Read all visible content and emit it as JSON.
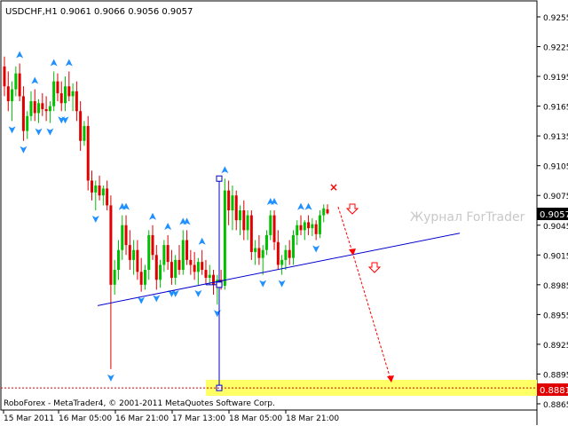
{
  "window": {
    "symbol_header": "USDCHF,H1  0.9061 0.9066 0.9056 0.9057",
    "footer_text": "RoboForex - MetaTrader4, © 2001-2011 MetaQuotes Software Corp.",
    "watermark": "Журнал ForTrader"
  },
  "chart_data": {
    "type": "candlestick",
    "title": "USDCHF,H1",
    "ohlc_header": {
      "open": 0.9061,
      "high": 0.9066,
      "low": 0.9056,
      "close": 0.9057
    },
    "ylim": [
      0.8865,
      0.9255
    ],
    "y_ticks": [
      "0.9255",
      "0.9225",
      "0.9195",
      "0.9165",
      "0.9135",
      "0.9105",
      "0.9075",
      "0.9045",
      "0.9015",
      "0.8985",
      "0.8955",
      "0.8925",
      "0.8895",
      "0.8865"
    ],
    "x_ticks": [
      "15 Mar 2011",
      "16 Mar 05:00",
      "16 Mar 21:00",
      "17 Mar 13:00",
      "18 Mar 05:00",
      "18 Mar 21:00"
    ],
    "current_price_label": "0.9057",
    "target_price_label": "0.8881",
    "current_price": 0.9057,
    "target_price": 0.8881,
    "trendline": {
      "x_start": "16 Mar 17:00",
      "y_start": 0.8964,
      "x_end": "19 Mar 10:00",
      "y_end": 0.9037
    },
    "forecast_path": [
      {
        "x": "18 Mar 23:00",
        "y": 0.9064
      },
      {
        "x": "19 Mar 01:00",
        "y": 0.9018
      },
      {
        "x": "19 Mar 03:00",
        "y": 0.892
      },
      {
        "x": "19 Mar 05:00",
        "y": 0.8888
      }
    ],
    "candles": [
      {
        "o": 0.9205,
        "h": 0.9215,
        "l": 0.9175,
        "c": 0.9185
      },
      {
        "o": 0.9185,
        "h": 0.92,
        "l": 0.916,
        "c": 0.917
      },
      {
        "o": 0.917,
        "h": 0.919,
        "l": 0.915,
        "c": 0.9182
      },
      {
        "o": 0.9182,
        "h": 0.9205,
        "l": 0.9175,
        "c": 0.9198
      },
      {
        "o": 0.9198,
        "h": 0.9208,
        "l": 0.917,
        "c": 0.9175
      },
      {
        "o": 0.9175,
        "h": 0.9185,
        "l": 0.913,
        "c": 0.914
      },
      {
        "o": 0.914,
        "h": 0.916,
        "l": 0.9132,
        "c": 0.9155
      },
      {
        "o": 0.9155,
        "h": 0.918,
        "l": 0.915,
        "c": 0.917
      },
      {
        "o": 0.917,
        "h": 0.9182,
        "l": 0.915,
        "c": 0.9158
      },
      {
        "o": 0.9158,
        "h": 0.9172,
        "l": 0.9148,
        "c": 0.9168
      },
      {
        "o": 0.9168,
        "h": 0.9178,
        "l": 0.9155,
        "c": 0.9162
      },
      {
        "o": 0.9162,
        "h": 0.9175,
        "l": 0.915,
        "c": 0.916
      },
      {
        "o": 0.916,
        "h": 0.917,
        "l": 0.9148,
        "c": 0.9165
      },
      {
        "o": 0.9165,
        "h": 0.92,
        "l": 0.916,
        "c": 0.919
      },
      {
        "o": 0.919,
        "h": 0.9198,
        "l": 0.917,
        "c": 0.9178
      },
      {
        "o": 0.9178,
        "h": 0.919,
        "l": 0.916,
        "c": 0.9168
      },
      {
        "o": 0.9168,
        "h": 0.9195,
        "l": 0.916,
        "c": 0.9185
      },
      {
        "o": 0.9185,
        "h": 0.92,
        "l": 0.917,
        "c": 0.9175
      },
      {
        "o": 0.9175,
        "h": 0.9188,
        "l": 0.916,
        "c": 0.918
      },
      {
        "o": 0.918,
        "h": 0.919,
        "l": 0.915,
        "c": 0.916
      },
      {
        "o": 0.916,
        "h": 0.917,
        "l": 0.912,
        "c": 0.913
      },
      {
        "o": 0.913,
        "h": 0.915,
        "l": 0.9125,
        "c": 0.9145
      },
      {
        "o": 0.9145,
        "h": 0.9155,
        "l": 0.908,
        "c": 0.909
      },
      {
        "o": 0.909,
        "h": 0.91,
        "l": 0.907,
        "c": 0.9078
      },
      {
        "o": 0.9078,
        "h": 0.909,
        "l": 0.906,
        "c": 0.9085
      },
      {
        "o": 0.9085,
        "h": 0.9095,
        "l": 0.907,
        "c": 0.9075
      },
      {
        "o": 0.9075,
        "h": 0.9085,
        "l": 0.9065,
        "c": 0.9082
      },
      {
        "o": 0.9082,
        "h": 0.909,
        "l": 0.906,
        "c": 0.9065
      },
      {
        "o": 0.9065,
        "h": 0.9075,
        "l": 0.89,
        "c": 0.8985
      },
      {
        "o": 0.8985,
        "h": 0.901,
        "l": 0.8975,
        "c": 0.9
      },
      {
        "o": 0.9,
        "h": 0.903,
        "l": 0.899,
        "c": 0.902
      },
      {
        "o": 0.902,
        "h": 0.9055,
        "l": 0.901,
        "c": 0.9045
      },
      {
        "o": 0.9045,
        "h": 0.9055,
        "l": 0.9015,
        "c": 0.9025
      },
      {
        "o": 0.9025,
        "h": 0.904,
        "l": 0.9,
        "c": 0.901
      },
      {
        "o": 0.901,
        "h": 0.903,
        "l": 0.8995,
        "c": 0.902
      },
      {
        "o": 0.902,
        "h": 0.903,
        "l": 0.899,
        "c": 0.8998
      },
      {
        "o": 0.8998,
        "h": 0.9012,
        "l": 0.8978,
        "c": 0.8985
      },
      {
        "o": 0.8985,
        "h": 0.9005,
        "l": 0.898,
        "c": 0.9
      },
      {
        "o": 0.9,
        "h": 0.904,
        "l": 0.899,
        "c": 0.9035
      },
      {
        "o": 0.9035,
        "h": 0.9045,
        "l": 0.901,
        "c": 0.9015
      },
      {
        "o": 0.9015,
        "h": 0.9025,
        "l": 0.898,
        "c": 0.899
      },
      {
        "o": 0.899,
        "h": 0.901,
        "l": 0.8982,
        "c": 0.9005
      },
      {
        "o": 0.9005,
        "h": 0.903,
        "l": 0.8998,
        "c": 0.9025
      },
      {
        "o": 0.9025,
        "h": 0.9035,
        "l": 0.9,
        "c": 0.9008
      },
      {
        "o": 0.9008,
        "h": 0.902,
        "l": 0.8985,
        "c": 0.8992
      },
      {
        "o": 0.8992,
        "h": 0.9015,
        "l": 0.8985,
        "c": 0.901
      },
      {
        "o": 0.901,
        "h": 0.9025,
        "l": 0.8995,
        "c": 0.9
      },
      {
        "o": 0.9,
        "h": 0.904,
        "l": 0.8995,
        "c": 0.903
      },
      {
        "o": 0.903,
        "h": 0.904,
        "l": 0.9005,
        "c": 0.901
      },
      {
        "o": 0.901,
        "h": 0.902,
        "l": 0.8995,
        "c": 0.9005
      },
      {
        "o": 0.9005,
        "h": 0.9018,
        "l": 0.899,
        "c": 0.8998
      },
      {
        "o": 0.8998,
        "h": 0.9012,
        "l": 0.8985,
        "c": 0.9008
      },
      {
        "o": 0.9008,
        "h": 0.902,
        "l": 0.8995,
        "c": 0.9
      },
      {
        "o": 0.9,
        "h": 0.901,
        "l": 0.8985,
        "c": 0.8992
      },
      {
        "o": 0.8992,
        "h": 0.9005,
        "l": 0.8985,
        "c": 0.8995
      },
      {
        "o": 0.8995,
        "h": 0.9,
        "l": 0.8975,
        "c": 0.8985
      },
      {
        "o": 0.8985,
        "h": 0.8995,
        "l": 0.8965,
        "c": 0.899
      },
      {
        "o": 0.899,
        "h": 0.9,
        "l": 0.898,
        "c": 0.8984
      },
      {
        "o": 0.8984,
        "h": 0.9092,
        "l": 0.898,
        "c": 0.908
      },
      {
        "o": 0.908,
        "h": 0.909,
        "l": 0.9045,
        "c": 0.906
      },
      {
        "o": 0.906,
        "h": 0.9085,
        "l": 0.904,
        "c": 0.9075
      },
      {
        "o": 0.9075,
        "h": 0.908,
        "l": 0.904,
        "c": 0.905
      },
      {
        "o": 0.905,
        "h": 0.9065,
        "l": 0.9035,
        "c": 0.906
      },
      {
        "o": 0.906,
        "h": 0.907,
        "l": 0.903,
        "c": 0.904
      },
      {
        "o": 0.904,
        "h": 0.906,
        "l": 0.903,
        "c": 0.9055
      },
      {
        "o": 0.9055,
        "h": 0.906,
        "l": 0.901,
        "c": 0.9018
      },
      {
        "o": 0.9018,
        "h": 0.903,
        "l": 0.9005,
        "c": 0.9022
      },
      {
        "o": 0.9022,
        "h": 0.9035,
        "l": 0.9005,
        "c": 0.9012
      },
      {
        "o": 0.9012,
        "h": 0.9025,
        "l": 0.8995,
        "c": 0.902
      },
      {
        "o": 0.902,
        "h": 0.904,
        "l": 0.9015,
        "c": 0.9035
      },
      {
        "o": 0.9035,
        "h": 0.906,
        "l": 0.903,
        "c": 0.9055
      },
      {
        "o": 0.9055,
        "h": 0.906,
        "l": 0.902,
        "c": 0.9028
      },
      {
        "o": 0.9028,
        "h": 0.904,
        "l": 0.9,
        "c": 0.9005
      },
      {
        "o": 0.9005,
        "h": 0.9015,
        "l": 0.8995,
        "c": 0.901
      },
      {
        "o": 0.901,
        "h": 0.9025,
        "l": 0.9,
        "c": 0.902
      },
      {
        "o": 0.902,
        "h": 0.903,
        "l": 0.9005,
        "c": 0.9012
      },
      {
        "o": 0.9012,
        "h": 0.904,
        "l": 0.9005,
        "c": 0.9035
      },
      {
        "o": 0.9035,
        "h": 0.905,
        "l": 0.9025,
        "c": 0.9045
      },
      {
        "o": 0.9045,
        "h": 0.9055,
        "l": 0.9035,
        "c": 0.904
      },
      {
        "o": 0.904,
        "h": 0.905,
        "l": 0.903,
        "c": 0.9048
      },
      {
        "o": 0.9048,
        "h": 0.9055,
        "l": 0.9035,
        "c": 0.9042
      },
      {
        "o": 0.9042,
        "h": 0.9052,
        "l": 0.9034,
        "c": 0.9046
      },
      {
        "o": 0.9046,
        "h": 0.905,
        "l": 0.903,
        "c": 0.9036
      },
      {
        "o": 0.9036,
        "h": 0.906,
        "l": 0.9032,
        "c": 0.9055
      },
      {
        "o": 0.9055,
        "h": 0.9066,
        "l": 0.9048,
        "c": 0.9062
      },
      {
        "o": 0.9061,
        "h": 0.9066,
        "l": 0.9056,
        "c": 0.9057
      }
    ]
  },
  "colors": {
    "bull": "#00c000",
    "bear": "#e00000",
    "fractal": "#1e90ff",
    "trendline": "#0000cc",
    "forecast": "#ff0000",
    "target_zone": "#ffff66",
    "grid_dash": "#c0c0c0"
  }
}
